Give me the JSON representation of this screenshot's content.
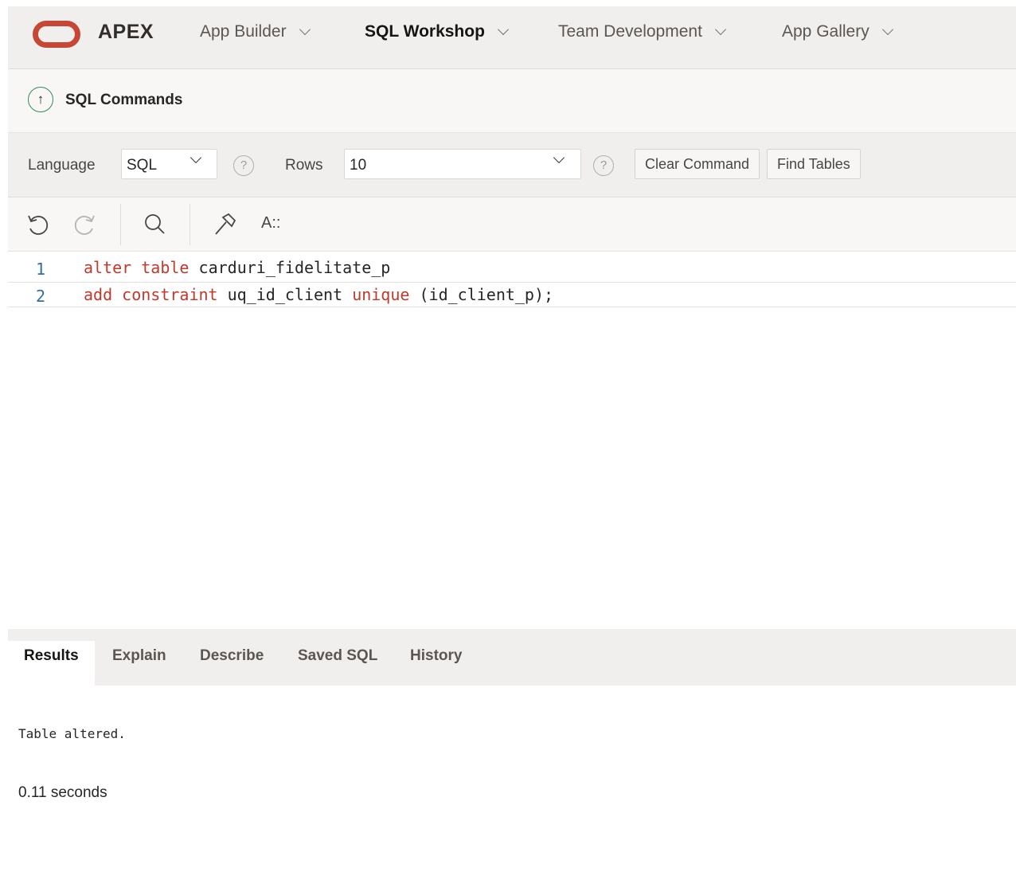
{
  "header": {
    "brand": "APEX",
    "nav": [
      {
        "label": "App Builder",
        "active": false
      },
      {
        "label": "SQL Workshop",
        "active": true
      },
      {
        "label": "Team Development",
        "active": false
      },
      {
        "label": "App Gallery",
        "active": false
      }
    ]
  },
  "page": {
    "title": "SQL Commands"
  },
  "options": {
    "language_label": "Language",
    "language_value": "SQL",
    "rows_label": "Rows",
    "rows_value": "10",
    "help_glyph": "?",
    "clear_label": "Clear Command",
    "find_label": "Find Tables"
  },
  "toolbar": {
    "format_label": "A::"
  },
  "editor": {
    "lines": [
      {
        "num": "1",
        "kw1": "alter",
        "kw2": "table",
        "rest": "carduri_fidelitate_p"
      },
      {
        "num": "2",
        "kw1": "add",
        "kw2": "constraint",
        "mid": "uq_id_client",
        "kw3": "unique",
        "rest": "(id_client_p);"
      }
    ]
  },
  "tabs": [
    {
      "label": "Results",
      "active": true
    },
    {
      "label": "Explain",
      "active": false
    },
    {
      "label": "Describe",
      "active": false
    },
    {
      "label": "Saved SQL",
      "active": false
    },
    {
      "label": "History",
      "active": false
    }
  ],
  "results": {
    "message": "Table altered.",
    "time": "0.11 seconds"
  },
  "colors": {
    "brand_red": "#c74634",
    "keyword": "#c0392b",
    "line_number": "#2f6fa3"
  }
}
